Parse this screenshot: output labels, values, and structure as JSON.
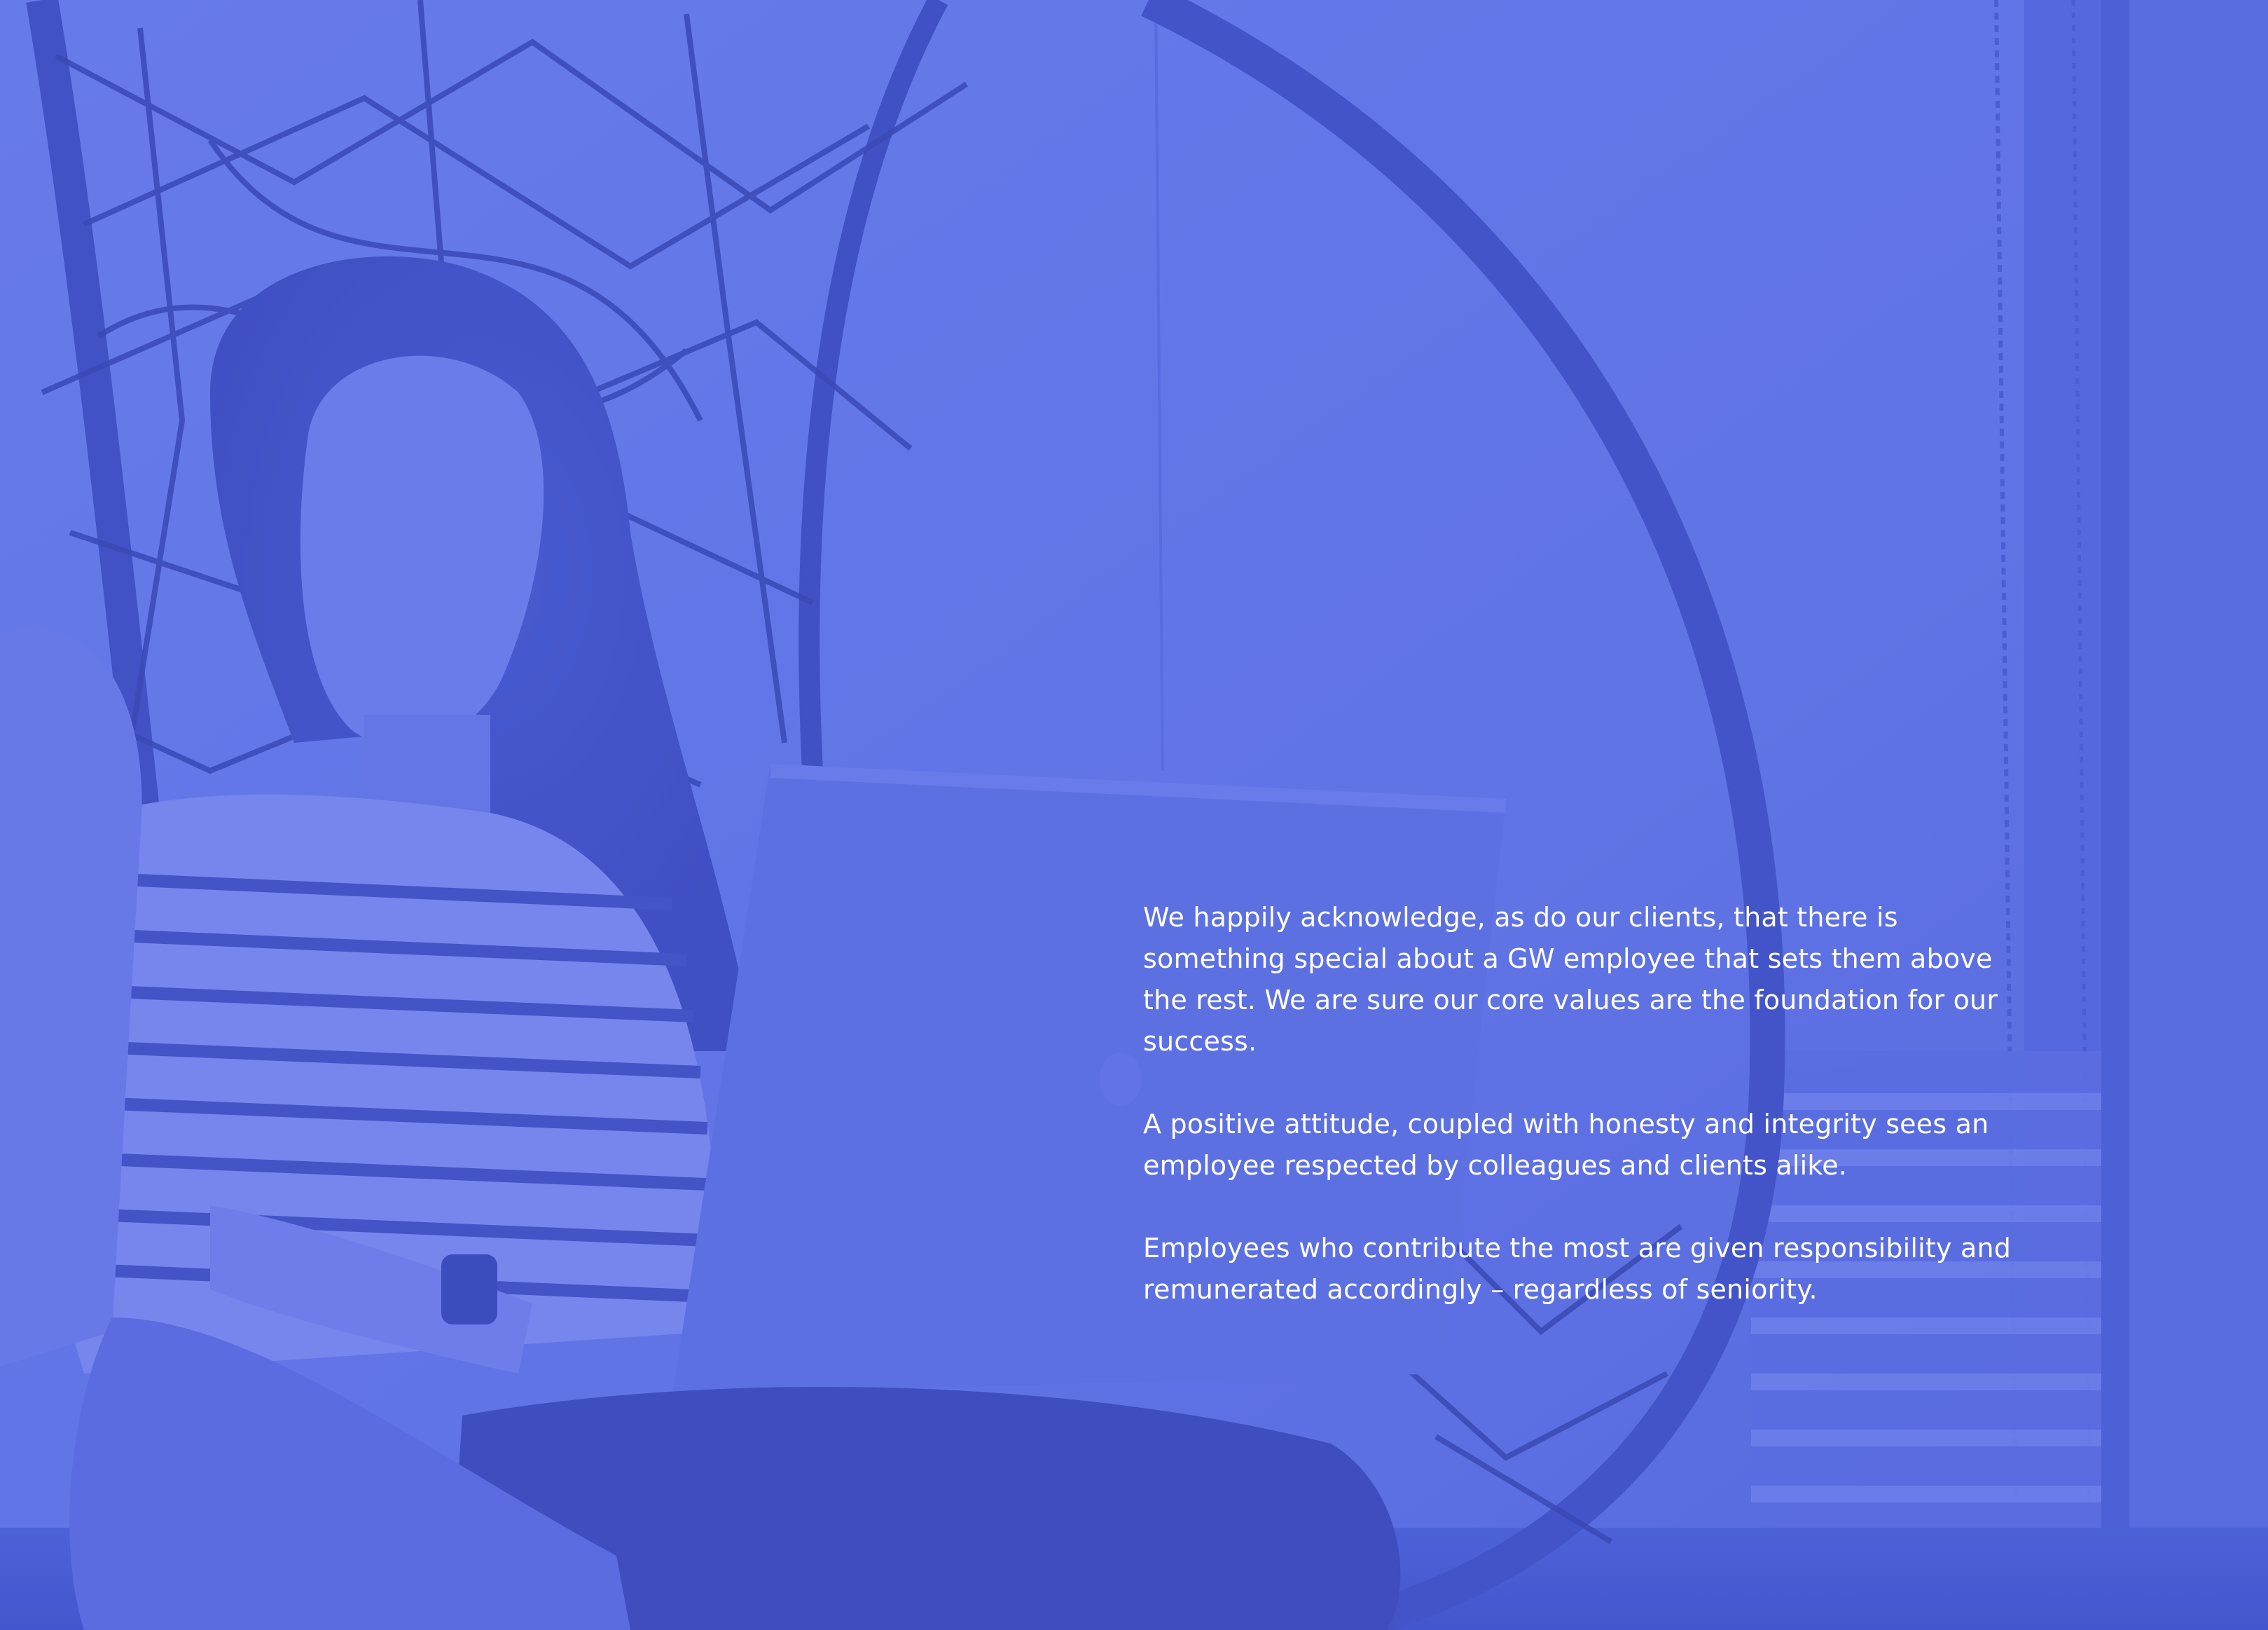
{
  "colors": {
    "overlay": "#5f72e4",
    "overlay_dark": "#3a4cc2",
    "overlay_light": "#7788ee",
    "text": "#ffffff"
  },
  "body": {
    "paragraphs": [
      "We happily acknowledge, as do our clients, that there is something special about a GW employee that sets them above the rest. We are sure our core values are the foundation for our success.",
      "A positive attitude, coupled with honesty and integrity sees an employee respected by colleagues and clients alike.",
      "Employees who contribute the most are given responsibility and remunerated accordingly – regardless of seniority."
    ]
  }
}
